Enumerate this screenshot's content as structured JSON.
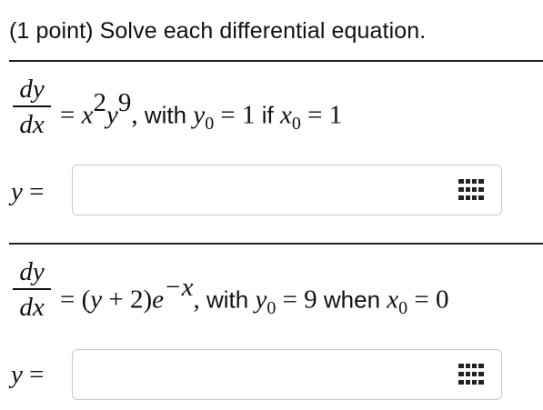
{
  "header": {
    "text": "(1 point) Solve each differential equation."
  },
  "problems": [
    {
      "lhs_num": "dy",
      "lhs_den": "dx",
      "eq": "=",
      "rhs_x": "x",
      "rhs_x_exp": "2",
      "rhs_y": "y",
      "rhs_y_exp": "9",
      "comma": ",",
      "with": "with",
      "y0_var": "y",
      "y0_sub": "0",
      "eq2": "=",
      "y0_val": "1",
      "cond_word": "if",
      "x0_var": "x",
      "x0_sub": "0",
      "eq3": "=",
      "x0_val": "1",
      "answer_label_var": "y",
      "answer_label_eq": "=",
      "answer_value": "",
      "answer_placeholder": ""
    },
    {
      "lhs_num": "dy",
      "lhs_den": "dx",
      "eq": "=",
      "rhs_open": "(",
      "rhs_y": "y",
      "rhs_plus": "+ 2)",
      "rhs_e": "e",
      "rhs_e_exp": "−x",
      "comma": ",",
      "with": "with",
      "y0_var": "y",
      "y0_sub": "0",
      "eq2": "=",
      "y0_val": "9",
      "cond_word": "when",
      "x0_var": "x",
      "x0_sub": "0",
      "eq3": "=",
      "x0_val": "0",
      "answer_label_var": "y",
      "answer_label_eq": "=",
      "answer_value": "",
      "answer_placeholder": ""
    }
  ],
  "icons": {
    "math_palette": "grid-icon"
  },
  "colors": {
    "rule": "#222222",
    "input_border": "#c9c9c9",
    "icon": "#222222"
  }
}
